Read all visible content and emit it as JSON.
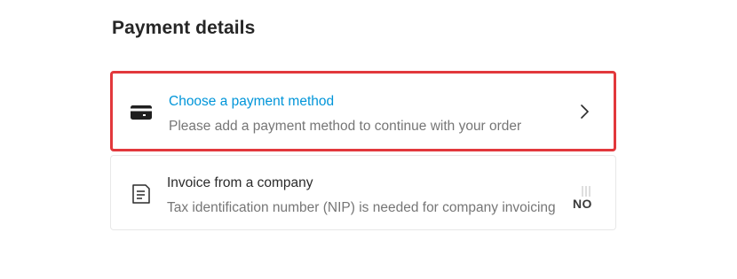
{
  "section": {
    "title": "Payment details"
  },
  "payment": {
    "icon": "credit-card-icon",
    "title": "Choose a payment method",
    "subtitle": "Please add a payment method to continue with your order",
    "highlight_color": "#e2383c",
    "link_color": "#0095d9"
  },
  "invoice": {
    "icon": "document-icon",
    "title": "Invoice from a company",
    "subtitle": "Tax identification number (NIP) is needed for company invoicing",
    "toggle_label": "NO"
  }
}
